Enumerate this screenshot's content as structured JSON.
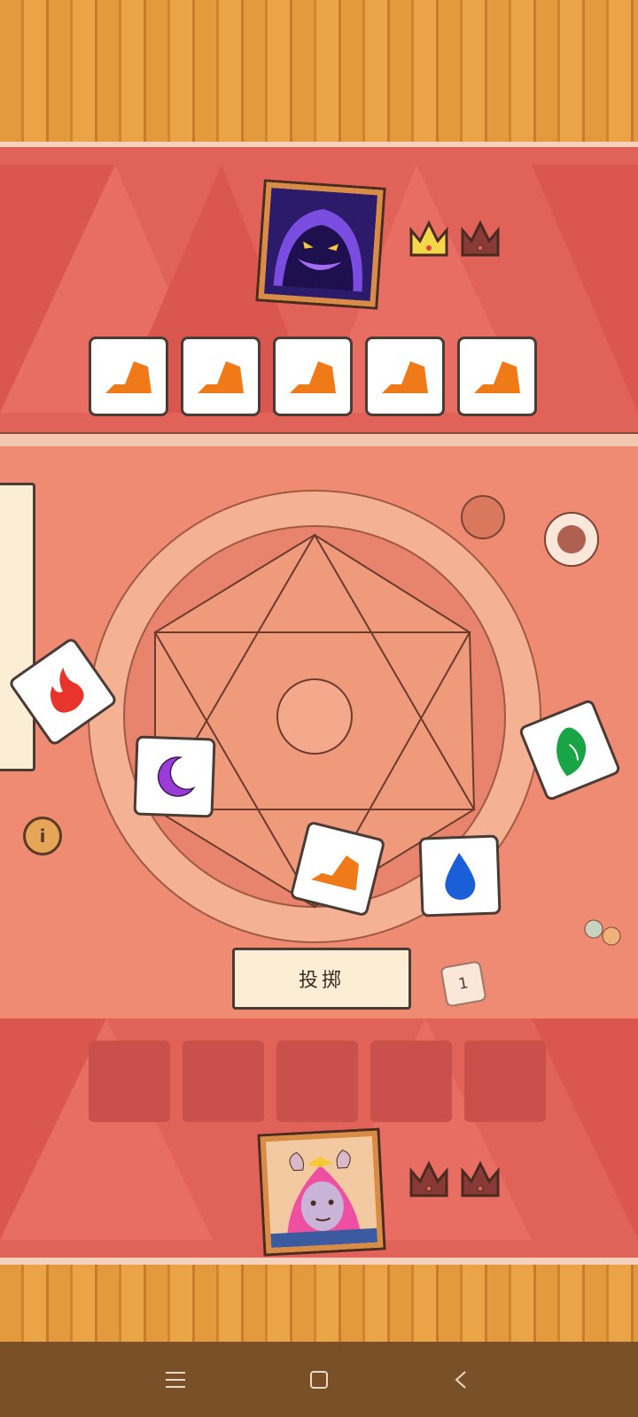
{
  "colors": {
    "banner": "#e06258",
    "table": "#ef8a73",
    "floor": "#e39a3c",
    "fire": "#e8342a",
    "moon": "#9b3bd8",
    "leaf": "#19a545",
    "water": "#1b5fd8",
    "earth": "#f07a18"
  },
  "enemy": {
    "portrait_icon": "shadow-demon-portrait",
    "crowns": [
      {
        "state": "won",
        "color": "#f4d64a"
      },
      {
        "state": "empty",
        "color": "#8a3a36"
      }
    ],
    "dice": [
      "earth",
      "earth",
      "earth",
      "earth",
      "earth"
    ]
  },
  "player": {
    "portrait_icon": "horned-girl-portrait",
    "crowns": [
      {
        "state": "empty",
        "color": "#8a3a36"
      },
      {
        "state": "empty",
        "color": "#8a3a36"
      }
    ],
    "slots": 5
  },
  "table_dice": [
    {
      "face": "fire",
      "icon": "fire-icon"
    },
    {
      "face": "moon",
      "icon": "moon-icon"
    },
    {
      "face": "earth",
      "icon": "earth-icon"
    },
    {
      "face": "water",
      "icon": "water-drop-icon"
    },
    {
      "face": "leaf",
      "icon": "leaf-icon"
    }
  ],
  "roll_button": {
    "label": "投掷"
  },
  "roll_counter": {
    "value": "1"
  }
}
